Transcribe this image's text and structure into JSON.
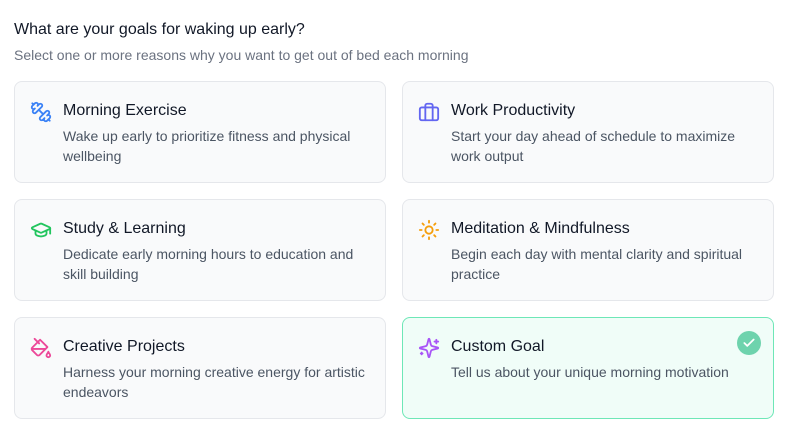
{
  "header": {
    "question": "What are your goals for waking up early?",
    "subtitle": "Select one or more reasons why you want to get out of bed each morning"
  },
  "colors": {
    "selected_border": "#6ee7b7",
    "selected_check": "#6ed3ad",
    "exercise_icon": "#3b82f6",
    "productivity_icon": "#6366f1",
    "study_icon": "#22c55e",
    "meditation_icon": "#f59e0b",
    "creative_icon": "#ec4899",
    "custom_icon": "#a855f7"
  },
  "goals": [
    {
      "title": "Morning Exercise",
      "description": "Wake up early to prioritize fitness and physical wellbeing",
      "icon": "dumbbell-icon",
      "selected": false
    },
    {
      "title": "Work Productivity",
      "description": "Start your day ahead of schedule to maximize work output",
      "icon": "briefcase-icon",
      "selected": false
    },
    {
      "title": "Study & Learning",
      "description": "Dedicate early morning hours to education and skill building",
      "icon": "graduation-cap-icon",
      "selected": false
    },
    {
      "title": "Meditation & Mindfulness",
      "description": "Begin each day with mental clarity and spiritual practice",
      "icon": "sun-icon",
      "selected": false
    },
    {
      "title": "Creative Projects",
      "description": "Harness your morning creative energy for artistic endeavors",
      "icon": "paint-bucket-icon",
      "selected": false
    },
    {
      "title": "Custom Goal",
      "description": "Tell us about your unique morning motivation",
      "icon": "sparkles-icon",
      "selected": true
    }
  ]
}
